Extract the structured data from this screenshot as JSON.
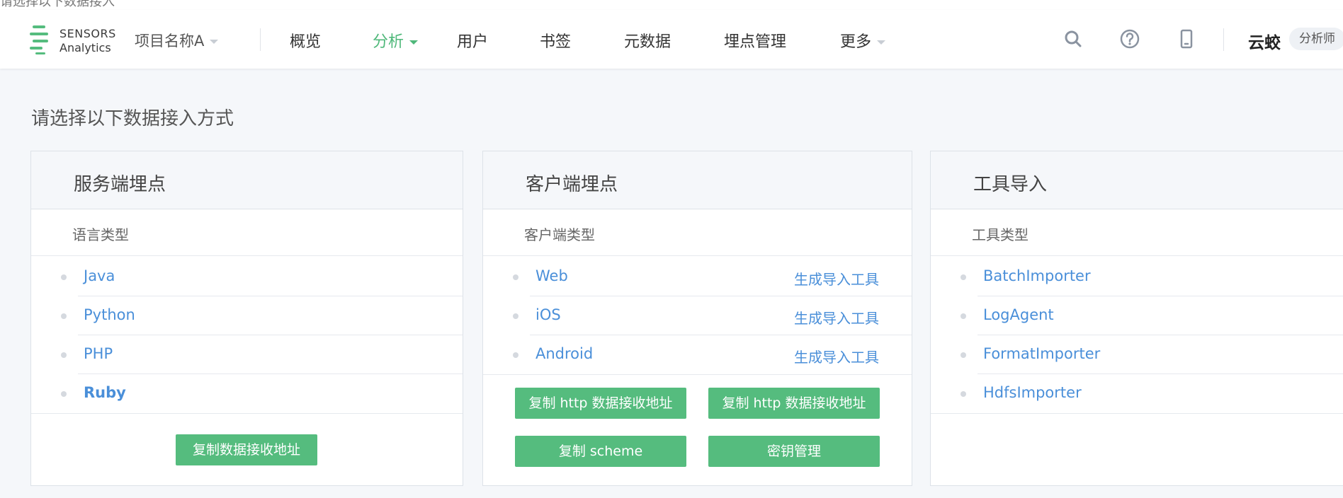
{
  "top_strip": {
    "text": "请选择以下数据接入"
  },
  "navbar": {
    "logo_line1": "SENSORS",
    "logo_line2": "Analytics",
    "project": "项目名称A",
    "items": [
      {
        "label": "概览"
      },
      {
        "label": "分析"
      },
      {
        "label": "用户"
      },
      {
        "label": "书签"
      },
      {
        "label": "元数据"
      },
      {
        "label": "埋点管理"
      },
      {
        "label": "更多"
      }
    ],
    "user": "云蛟",
    "role": "分析师"
  },
  "page": {
    "heading": "请选择以下数据接入方式"
  },
  "cards": {
    "server": {
      "title": "服务端埋点",
      "subtitle": "语言类型",
      "items": [
        "Java",
        "Python",
        "PHP",
        "Ruby"
      ],
      "button": "复制数据接收地址"
    },
    "client": {
      "title": "客户端埋点",
      "subtitle": "客户端类型",
      "items": [
        "Web",
        "iOS",
        "Android"
      ],
      "action": "生成导入工具",
      "buttons": [
        "复制 http 数据接收地址",
        "复制 http 数据接收地址",
        "复制 scheme",
        "密钥管理"
      ]
    },
    "tools": {
      "title": "工具导入",
      "subtitle": "工具类型",
      "items": [
        "BatchImporter",
        "LogAgent",
        "FormatImporter",
        "HdfsImporter"
      ]
    }
  },
  "colors": {
    "accent": "#55bc7e",
    "link": "#4a8fd9"
  },
  "icons": [
    "search-icon",
    "help-icon",
    "mobile-icon",
    "caret-down-icon"
  ]
}
